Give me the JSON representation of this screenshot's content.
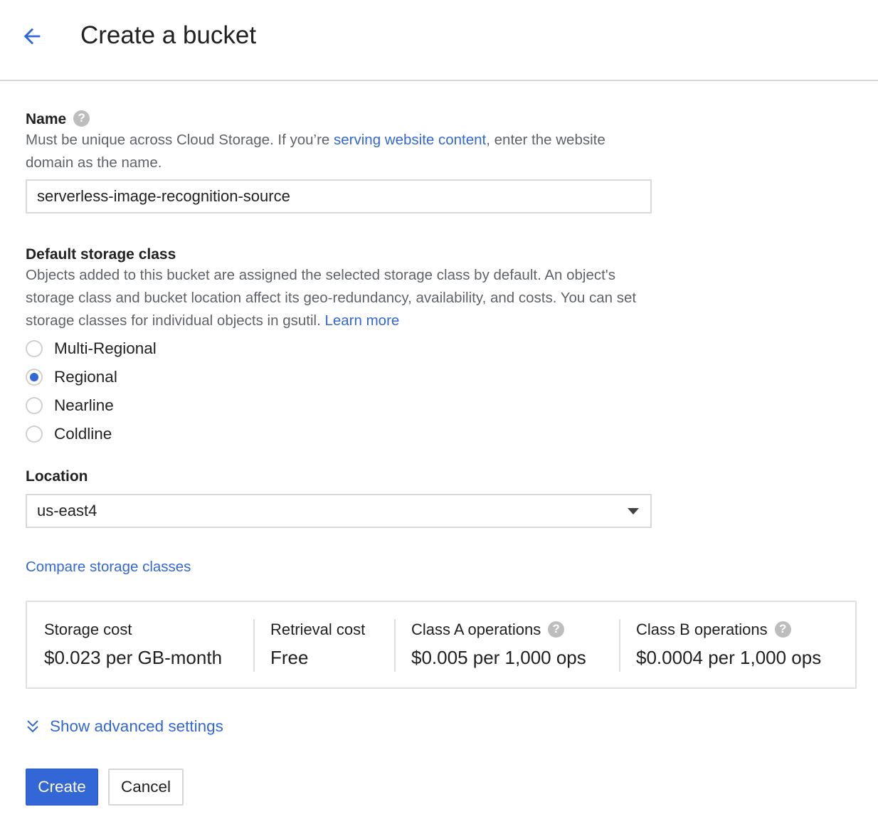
{
  "header": {
    "title": "Create a bucket"
  },
  "name_field": {
    "label": "Name",
    "help": "?",
    "desc_before": "Must be unique across Cloud Storage. If you’re ",
    "desc_link": "serving website content",
    "desc_after": ", enter the website domain as the name.",
    "value": "serverless-image-recognition-source"
  },
  "storage_class": {
    "label": "Default storage class",
    "desc": "Objects added to this bucket are assigned the selected storage class by default. An object's storage class and bucket location affect its geo-redundancy, availability, and costs. You can set storage classes for individual objects in gsutil. ",
    "learn_more": "Learn more",
    "options": [
      {
        "label": "Multi-Regional",
        "checked": false
      },
      {
        "label": "Regional",
        "checked": true
      },
      {
        "label": "Nearline",
        "checked": false
      },
      {
        "label": "Coldline",
        "checked": false
      }
    ]
  },
  "location": {
    "label": "Location",
    "value": "us-east4"
  },
  "compare_link": "Compare storage classes",
  "costs": [
    {
      "title": "Storage cost",
      "value": "$0.023 per GB-month",
      "help": false
    },
    {
      "title": "Retrieval cost",
      "value": "Free",
      "help": false
    },
    {
      "title": "Class A operations",
      "value": "$0.005 per 1,000 ops",
      "help": true
    },
    {
      "title": "Class B operations",
      "value": "$0.0004 per 1,000 ops",
      "help": true
    }
  ],
  "help_glyph": "?",
  "advanced": {
    "label": "Show advanced settings"
  },
  "buttons": {
    "create": "Create",
    "cancel": "Cancel"
  },
  "colors": {
    "accent": "#3367d6",
    "text": "#212121",
    "muted": "#5f6368",
    "border": "#d8d8d8"
  },
  "icons": {
    "back": "arrow-back-icon",
    "help": "help-circle-icon",
    "caret": "caret-down-icon",
    "expand": "double-chevron-down-icon"
  }
}
